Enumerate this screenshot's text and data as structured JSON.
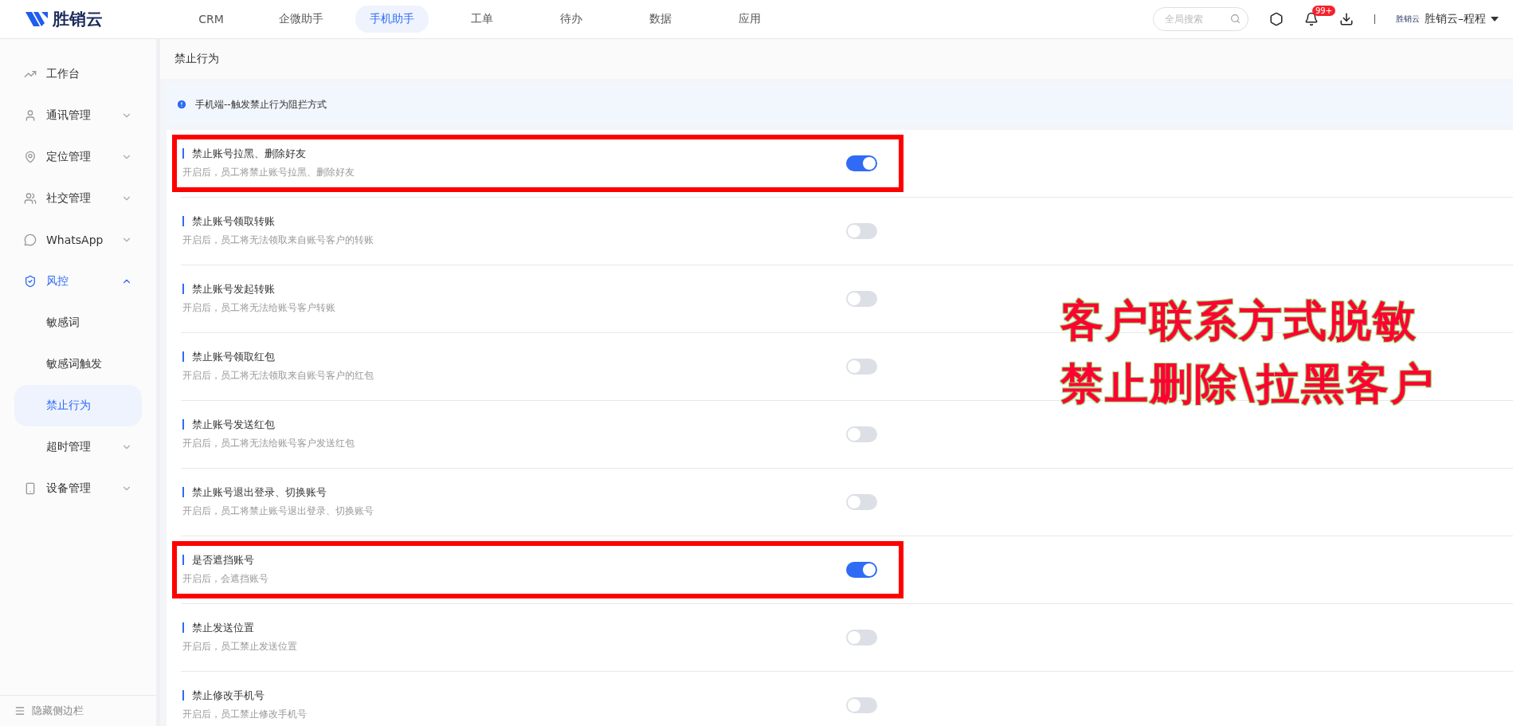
{
  "brand": {
    "name": "胜销云"
  },
  "nav": [
    {
      "label": "CRM",
      "selected": false
    },
    {
      "label": "企微助手",
      "selected": false
    },
    {
      "label": "手机助手",
      "selected": true
    },
    {
      "label": "工单",
      "selected": false
    },
    {
      "label": "待办",
      "selected": false
    },
    {
      "label": "数据",
      "selected": false
    },
    {
      "label": "应用",
      "selected": false
    }
  ],
  "search": {
    "placeholder": "全局搜索"
  },
  "notifications": {
    "badge": "99+"
  },
  "account": {
    "logo_text": "胜销云",
    "name": "胜销云–程程"
  },
  "sidebar": {
    "items": [
      {
        "label": "工作台",
        "expandable": false
      },
      {
        "label": "通讯管理",
        "expandable": true,
        "expanded": false
      },
      {
        "label": "定位管理",
        "expandable": true,
        "expanded": false
      },
      {
        "label": "社交管理",
        "expandable": true,
        "expanded": false
      },
      {
        "label": "WhatsApp",
        "expandable": true,
        "expanded": false
      },
      {
        "label": "风控",
        "expandable": true,
        "expanded": true,
        "children": [
          {
            "label": "敏感词",
            "selected": false,
            "expandable": false
          },
          {
            "label": "敏感词触发",
            "selected": false,
            "expandable": false
          },
          {
            "label": "禁止行为",
            "selected": true,
            "expandable": false
          },
          {
            "label": "超时管理",
            "selected": false,
            "expandable": true
          }
        ]
      },
      {
        "label": "设备管理",
        "expandable": true,
        "expanded": false
      }
    ],
    "footer": "隐藏侧边栏"
  },
  "page": {
    "title": "禁止行为",
    "notice": "手机端--触发禁止行为阻拦方式"
  },
  "rules": [
    {
      "title": "禁止账号拉黑、删除好友",
      "description": "开启后，员工将禁止账号拉黑、删除好友",
      "on": true,
      "highlighted": true
    },
    {
      "title": "禁止账号领取转账",
      "description": "开启后，员工将无法领取来自账号客户的转账",
      "on": false,
      "highlighted": false
    },
    {
      "title": "禁止账号发起转账",
      "description": "开启后，员工将无法给账号客户转账",
      "on": false,
      "highlighted": false
    },
    {
      "title": "禁止账号领取红包",
      "description": "开启后，员工将无法领取来自账号客户的红包",
      "on": false,
      "highlighted": false
    },
    {
      "title": "禁止账号发送红包",
      "description": "开启后，员工将无法给账号客户发送红包",
      "on": false,
      "highlighted": false
    },
    {
      "title": "禁止账号退出登录、切换账号",
      "description": "开启后，员工将禁止账号退出登录、切换账号",
      "on": false,
      "highlighted": false
    },
    {
      "title": "是否遮挡账号",
      "description": "开启后，会遮挡账号",
      "on": true,
      "highlighted": true
    },
    {
      "title": "禁止发送位置",
      "description": "开启后，员工禁止发送位置",
      "on": false,
      "highlighted": false
    },
    {
      "title": "禁止修改手机号",
      "description": "开启后，员工禁止修改手机号",
      "on": false,
      "highlighted": false
    }
  ],
  "annotation": {
    "lines": [
      "客户联系方式脱敏",
      "禁止删除\\拉黑客户"
    ]
  }
}
